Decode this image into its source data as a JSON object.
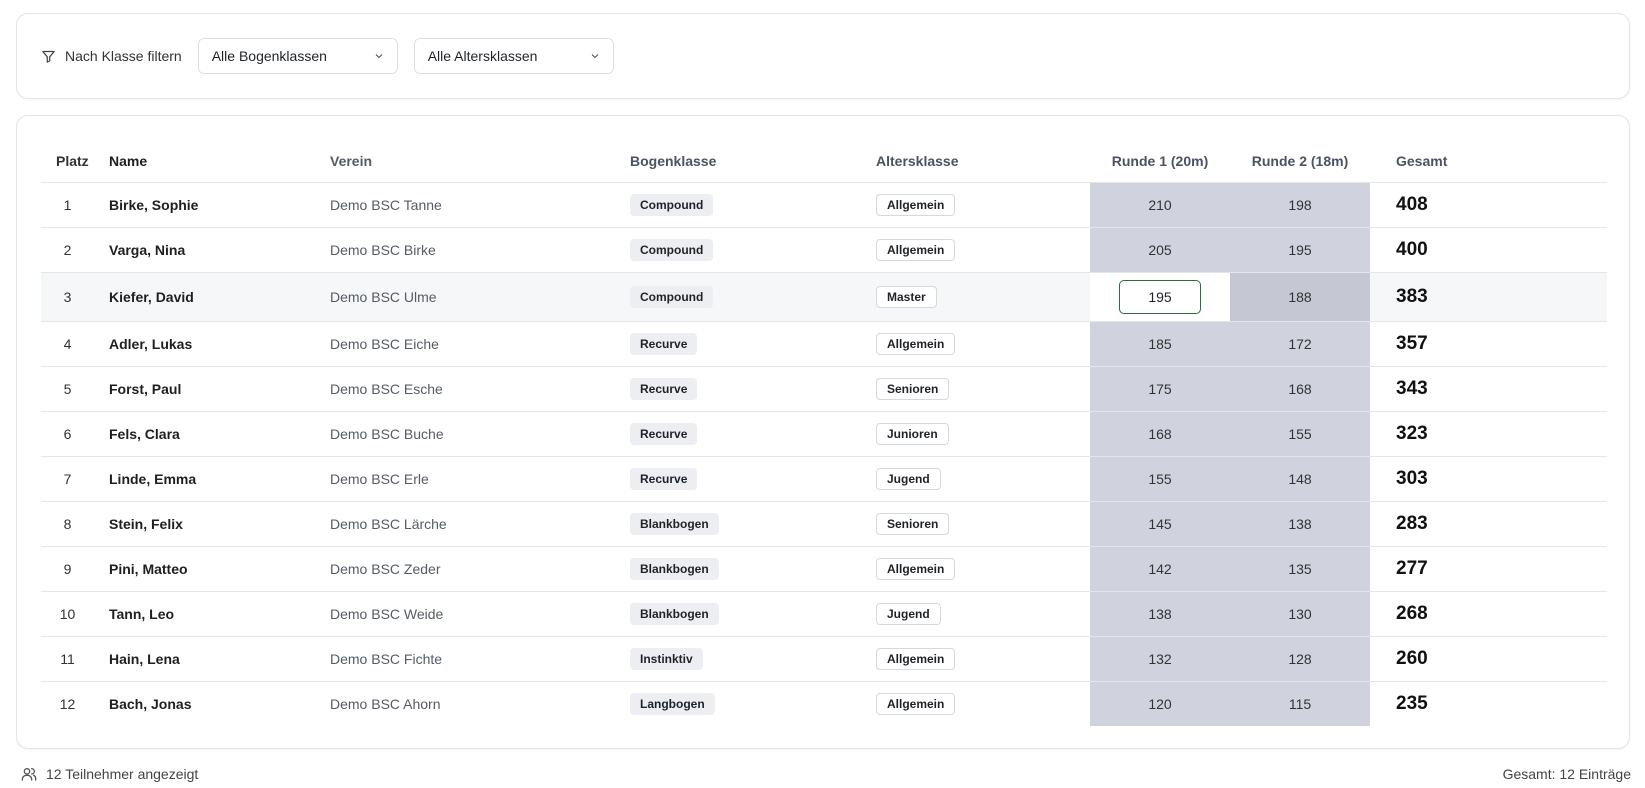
{
  "filter": {
    "label": "Nach Klasse filtern",
    "bow_select": "Alle Bogenklassen",
    "age_select": "Alle Altersklassen"
  },
  "table": {
    "headers": {
      "platz": "Platz",
      "name": "Name",
      "verein": "Verein",
      "bogenklasse": "Bogenklasse",
      "altersklasse": "Altersklasse",
      "runde1": "Runde 1 (20m)",
      "runde2": "Runde 2 (18m)",
      "gesamt": "Gesamt"
    },
    "rows": [
      {
        "platz": "1",
        "name": "Birke, Sophie",
        "verein": "Demo BSC Tanne",
        "bogen": "Compound",
        "alter": "Allgemein",
        "r1": "210",
        "r2": "198",
        "total": "408"
      },
      {
        "platz": "2",
        "name": "Varga, Nina",
        "verein": "Demo BSC Birke",
        "bogen": "Compound",
        "alter": "Allgemein",
        "r1": "205",
        "r2": "195",
        "total": "400"
      },
      {
        "platz": "3",
        "name": "Kiefer, David",
        "verein": "Demo BSC Ulme",
        "bogen": "Compound",
        "alter": "Master",
        "r1": "195",
        "r2": "188",
        "total": "383",
        "editing": true
      },
      {
        "platz": "4",
        "name": "Adler, Lukas",
        "verein": "Demo BSC Eiche",
        "bogen": "Recurve",
        "alter": "Allgemein",
        "r1": "185",
        "r2": "172",
        "total": "357"
      },
      {
        "platz": "5",
        "name": "Forst, Paul",
        "verein": "Demo BSC Esche",
        "bogen": "Recurve",
        "alter": "Senioren",
        "r1": "175",
        "r2": "168",
        "total": "343"
      },
      {
        "platz": "6",
        "name": "Fels, Clara",
        "verein": "Demo BSC Buche",
        "bogen": "Recurve",
        "alter": "Junioren",
        "r1": "168",
        "r2": "155",
        "total": "323"
      },
      {
        "platz": "7",
        "name": "Linde, Emma",
        "verein": "Demo BSC Erle",
        "bogen": "Recurve",
        "alter": "Jugend",
        "r1": "155",
        "r2": "148",
        "total": "303"
      },
      {
        "platz": "8",
        "name": "Stein, Felix",
        "verein": "Demo BSC Lärche",
        "bogen": "Blankbogen",
        "alter": "Senioren",
        "r1": "145",
        "r2": "138",
        "total": "283"
      },
      {
        "platz": "9",
        "name": "Pini, Matteo",
        "verein": "Demo BSC Zeder",
        "bogen": "Blankbogen",
        "alter": "Allgemein",
        "r1": "142",
        "r2": "135",
        "total": "277"
      },
      {
        "platz": "10",
        "name": "Tann, Leo",
        "verein": "Demo BSC Weide",
        "bogen": "Blankbogen",
        "alter": "Jugend",
        "r1": "138",
        "r2": "130",
        "total": "268"
      },
      {
        "platz": "11",
        "name": "Hain, Lena",
        "verein": "Demo BSC Fichte",
        "bogen": "Instinktiv",
        "alter": "Allgemein",
        "r1": "132",
        "r2": "128",
        "total": "260"
      },
      {
        "platz": "12",
        "name": "Bach, Jonas",
        "verein": "Demo BSC Ahorn",
        "bogen": "Langbogen",
        "alter": "Allgemein",
        "r1": "120",
        "r2": "115",
        "total": "235"
      }
    ]
  },
  "footer": {
    "count_text": "12 Teilnehmer angezeigt",
    "total_text": "Gesamt: 12 Einträge"
  },
  "icons": {
    "filter": "filter-icon",
    "chevron": "chevron-down-icon",
    "users": "users-icon"
  },
  "colors": {
    "round_bg": "#d0d3de",
    "edit_border": "#2e6b3a"
  }
}
